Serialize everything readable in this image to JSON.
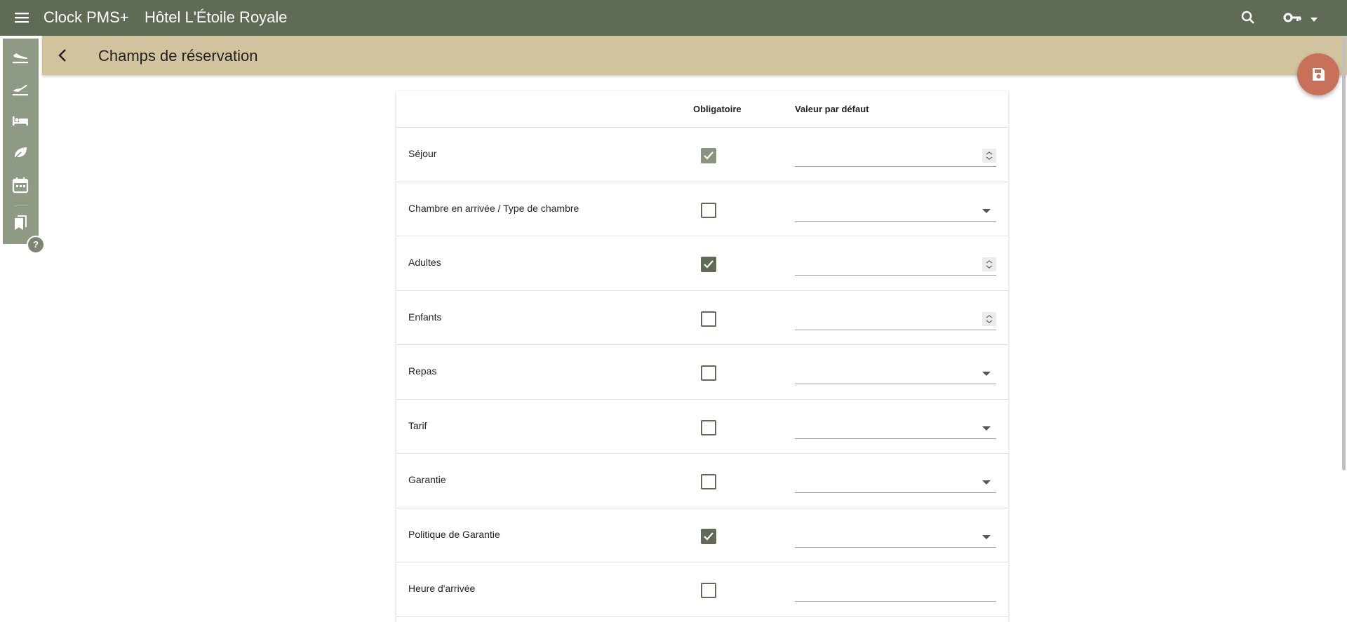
{
  "header": {
    "app_name": "Clock PMS+",
    "hotel_name": "Hôtel L'Étoile Royale",
    "icons": [
      "menu-icon",
      "search-icon",
      "key-icon",
      "chevron-down-icon"
    ],
    "color": "#5f6b55"
  },
  "subheader": {
    "title": "Champs de réservation",
    "color": "#d2c39f"
  },
  "sidebar": {
    "icons": [
      "flight-land-icon",
      "flight-takeoff-icon",
      "bed-icon",
      "leaf-icon",
      "calendar-icon",
      "bookmarks-icon"
    ],
    "help": "?"
  },
  "save_button": {
    "icon": "save-icon",
    "color": "#c7705a"
  },
  "table": {
    "headers": {
      "required": "Obligatoire",
      "default_value": "Valeur par défaut"
    },
    "rows": [
      {
        "label": "Séjour",
        "required": true,
        "disabled": true,
        "input": "number"
      },
      {
        "label": "Chambre en arrivée / Type de chambre",
        "required": false,
        "input": "select"
      },
      {
        "label": "Adultes",
        "required": true,
        "input": "number"
      },
      {
        "label": "Enfants",
        "required": false,
        "input": "number"
      },
      {
        "label": "Repas",
        "required": false,
        "input": "select"
      },
      {
        "label": "Tarif",
        "required": false,
        "input": "select"
      },
      {
        "label": "Garantie",
        "required": false,
        "input": "select"
      },
      {
        "label": "Politique de Garantie",
        "required": true,
        "input": "select"
      },
      {
        "label": "Heure d'arrivée",
        "required": false,
        "input": "text"
      }
    ]
  }
}
